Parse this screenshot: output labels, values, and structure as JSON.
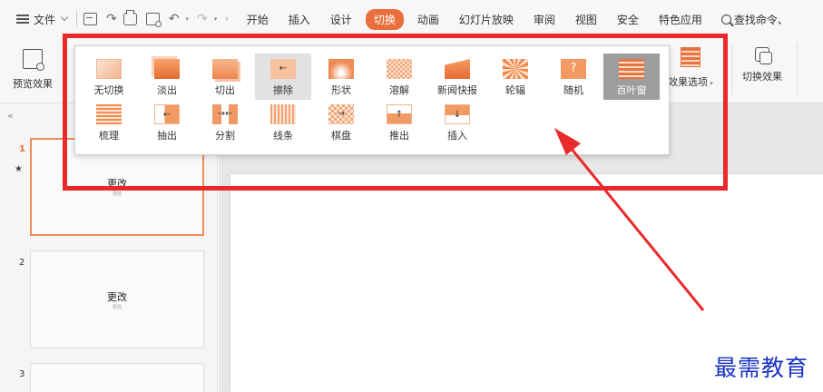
{
  "menubar": {
    "file_label": "文件",
    "tabs": [
      {
        "label": "开始",
        "active": false
      },
      {
        "label": "插入",
        "active": false
      },
      {
        "label": "设计",
        "active": false
      },
      {
        "label": "切换",
        "active": true
      },
      {
        "label": "动画",
        "active": false
      },
      {
        "label": "幻灯片放映",
        "active": false
      },
      {
        "label": "审阅",
        "active": false
      },
      {
        "label": "视图",
        "active": false
      },
      {
        "label": "安全",
        "active": false
      },
      {
        "label": "特色应用",
        "active": false
      }
    ],
    "search_label": "查找命令、",
    "active_color": "#e9703d"
  },
  "ribbon": {
    "preview_label": "预览效果",
    "options_label": "效果选项",
    "switch_effect_label": "切换效果"
  },
  "gallery": {
    "row1": [
      {
        "label": "无切换",
        "icon": "no-transition-icon"
      },
      {
        "label": "淡出",
        "icon": "fade-icon"
      },
      {
        "label": "切出",
        "icon": "cut-icon"
      },
      {
        "label": "擦除",
        "icon": "wipe-icon"
      },
      {
        "label": "形状",
        "icon": "shape-icon"
      },
      {
        "label": "溶解",
        "icon": "dissolve-icon"
      },
      {
        "label": "新闻快报",
        "icon": "newsflash-icon"
      },
      {
        "label": "轮辐",
        "icon": "wheel-icon"
      },
      {
        "label": "随机",
        "icon": "random-icon"
      },
      {
        "label": "百叶窗",
        "icon": "blinds-icon"
      }
    ],
    "row2": [
      {
        "label": "梳理",
        "icon": "comb-icon"
      },
      {
        "label": "抽出",
        "icon": "pull-icon"
      },
      {
        "label": "分割",
        "icon": "split-icon"
      },
      {
        "label": "线条",
        "icon": "lines-icon"
      },
      {
        "label": "棋盘",
        "icon": "checkerboard-icon"
      },
      {
        "label": "推出",
        "icon": "push-icon"
      },
      {
        "label": "插入",
        "icon": "insert-icon"
      }
    ],
    "random_glyph": "?"
  },
  "slides": [
    {
      "number": "1",
      "title": "更改",
      "subtitle": "更改"
    },
    {
      "number": "2",
      "title": "更改",
      "subtitle": "更改"
    },
    {
      "number": "3",
      "title": "",
      "subtitle": ""
    }
  ],
  "annotation_color": "#ea2a2a",
  "watermark": "最需教育"
}
